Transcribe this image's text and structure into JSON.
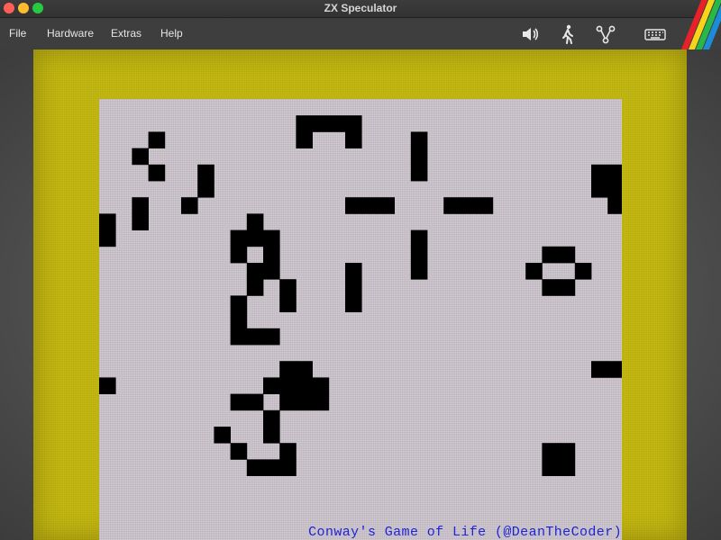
{
  "window": {
    "title": "ZX Speculator"
  },
  "menu": {
    "items": [
      "File",
      "Hardware",
      "Extras",
      "Help"
    ]
  },
  "toolbar": {
    "icons": [
      "speaker-icon",
      "walking-person-icon",
      "network-icon",
      "keyboard-icon"
    ]
  },
  "brand": {
    "stripe_colors": [
      "#e8202a",
      "#f5d41a",
      "#28b84a",
      "#1e8bd6"
    ]
  },
  "screen": {
    "border_color": "#c8bb12",
    "paper_color": "#d3cbd3",
    "ink_color": "#000000",
    "caption": "Conway's Game of Life (@DeanTheCoder)",
    "caption_color": "#1c24d8",
    "cells": [
      [
        12,
        1
      ],
      [
        13,
        1
      ],
      [
        14,
        1
      ],
      [
        15,
        1
      ],
      [
        12,
        2
      ],
      [
        15,
        2
      ],
      [
        3,
        2
      ],
      [
        2,
        3
      ],
      [
        3,
        4
      ],
      [
        19,
        2
      ],
      [
        19,
        3
      ],
      [
        19,
        4
      ],
      [
        30,
        4
      ],
      [
        31,
        4
      ],
      [
        30,
        5
      ],
      [
        31,
        5
      ],
      [
        31,
        6
      ],
      [
        6,
        4
      ],
      [
        6,
        5
      ],
      [
        5,
        6
      ],
      [
        2,
        6
      ],
      [
        2,
        7
      ],
      [
        15,
        6
      ],
      [
        16,
        6
      ],
      [
        17,
        6
      ],
      [
        21,
        6
      ],
      [
        22,
        6
      ],
      [
        23,
        6
      ],
      [
        0,
        7
      ],
      [
        0,
        8
      ],
      [
        9,
        7
      ],
      [
        8,
        8
      ],
      [
        9,
        8
      ],
      [
        8,
        9
      ],
      [
        10,
        8
      ],
      [
        19,
        8
      ],
      [
        19,
        9
      ],
      [
        19,
        10
      ],
      [
        27,
        9
      ],
      [
        28,
        9
      ],
      [
        26,
        10
      ],
      [
        29,
        10
      ],
      [
        27,
        11
      ],
      [
        28,
        11
      ],
      [
        10,
        9
      ],
      [
        10,
        10
      ],
      [
        9,
        10
      ],
      [
        9,
        11
      ],
      [
        11,
        11
      ],
      [
        11,
        12
      ],
      [
        15,
        10
      ],
      [
        15,
        11
      ],
      [
        15,
        12
      ],
      [
        8,
        12
      ],
      [
        8,
        13
      ],
      [
        8,
        14
      ],
      [
        9,
        14
      ],
      [
        10,
        14
      ],
      [
        11,
        16
      ],
      [
        12,
        16
      ],
      [
        30,
        16
      ],
      [
        31,
        16
      ],
      [
        0,
        17
      ],
      [
        10,
        17
      ],
      [
        11,
        17
      ],
      [
        12,
        17
      ],
      [
        13,
        17
      ],
      [
        8,
        18
      ],
      [
        9,
        18
      ],
      [
        11,
        18
      ],
      [
        12,
        18
      ],
      [
        13,
        18
      ],
      [
        10,
        19
      ],
      [
        10,
        20
      ],
      [
        7,
        20
      ],
      [
        8,
        21
      ],
      [
        11,
        21
      ],
      [
        9,
        22
      ],
      [
        10,
        22
      ],
      [
        11,
        22
      ],
      [
        27,
        21
      ],
      [
        28,
        21
      ],
      [
        27,
        22
      ],
      [
        28,
        22
      ]
    ]
  }
}
